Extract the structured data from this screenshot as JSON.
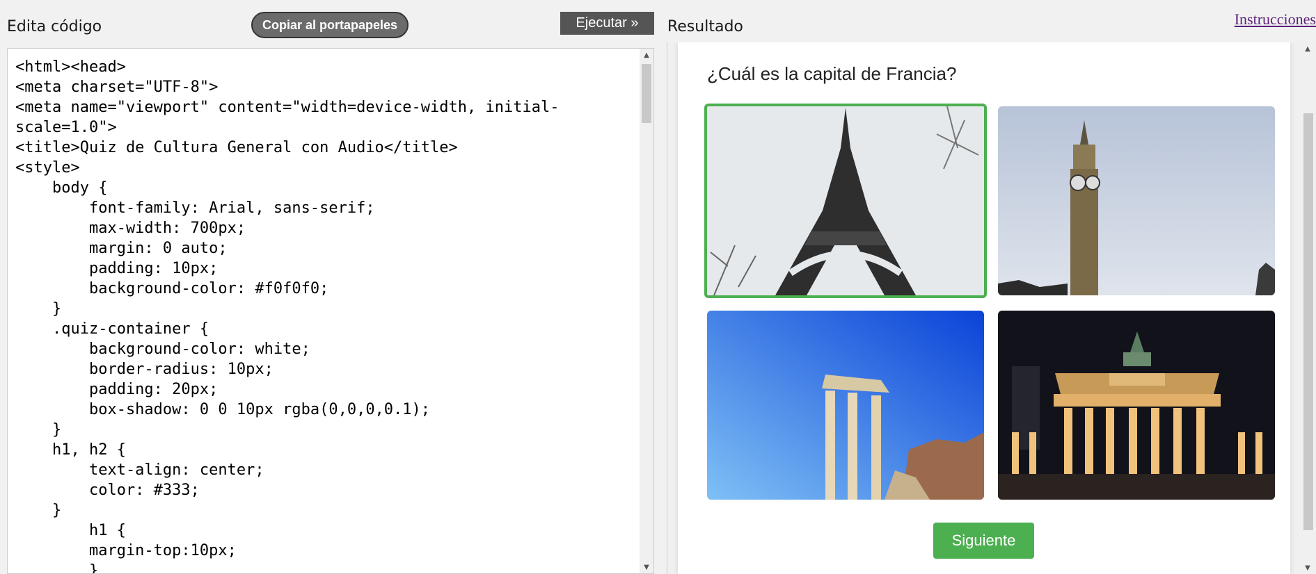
{
  "header": {
    "editor_label": "Edita código",
    "copy_button": "Copiar al portapapeles",
    "run_button": "Ejecutar »",
    "result_label": "Resultado",
    "instructions_link": "Instrucciones"
  },
  "editor": {
    "code": "<html><head>\n<meta charset=\"UTF-8\">\n<meta name=\"viewport\" content=\"width=device-width, initial-\nscale=1.0\">\n<title>Quiz de Cultura General con Audio</title>\n<style>\n    body {\n        font-family: Arial, sans-serif;\n        max-width: 700px;\n        margin: 0 auto;\n        padding: 10px;\n        background-color: #f0f0f0;\n    }\n    .quiz-container {\n        background-color: white;\n        border-radius: 10px;\n        padding: 20px;\n        box-shadow: 0 0 10px rgba(0,0,0,0.1);\n    }\n    h1, h2 {\n        text-align: center;\n        color: #333;\n    }\n        h1 {\n        margin-top:10px;\n        }"
  },
  "result": {
    "question": "¿Cuál es la capital de Francia?",
    "options": [
      {
        "icon": "eiffel-tower-image",
        "selected": true
      },
      {
        "icon": "big-ben-image",
        "selected": false
      },
      {
        "icon": "greek-temple-image",
        "selected": false
      },
      {
        "icon": "brandenburg-gate-image",
        "selected": false
      }
    ],
    "next_button": "Siguiente"
  },
  "colors": {
    "accent_green": "#4caf50",
    "run_button_bg": "#555555",
    "copy_button_bg": "#6b6b6b"
  }
}
